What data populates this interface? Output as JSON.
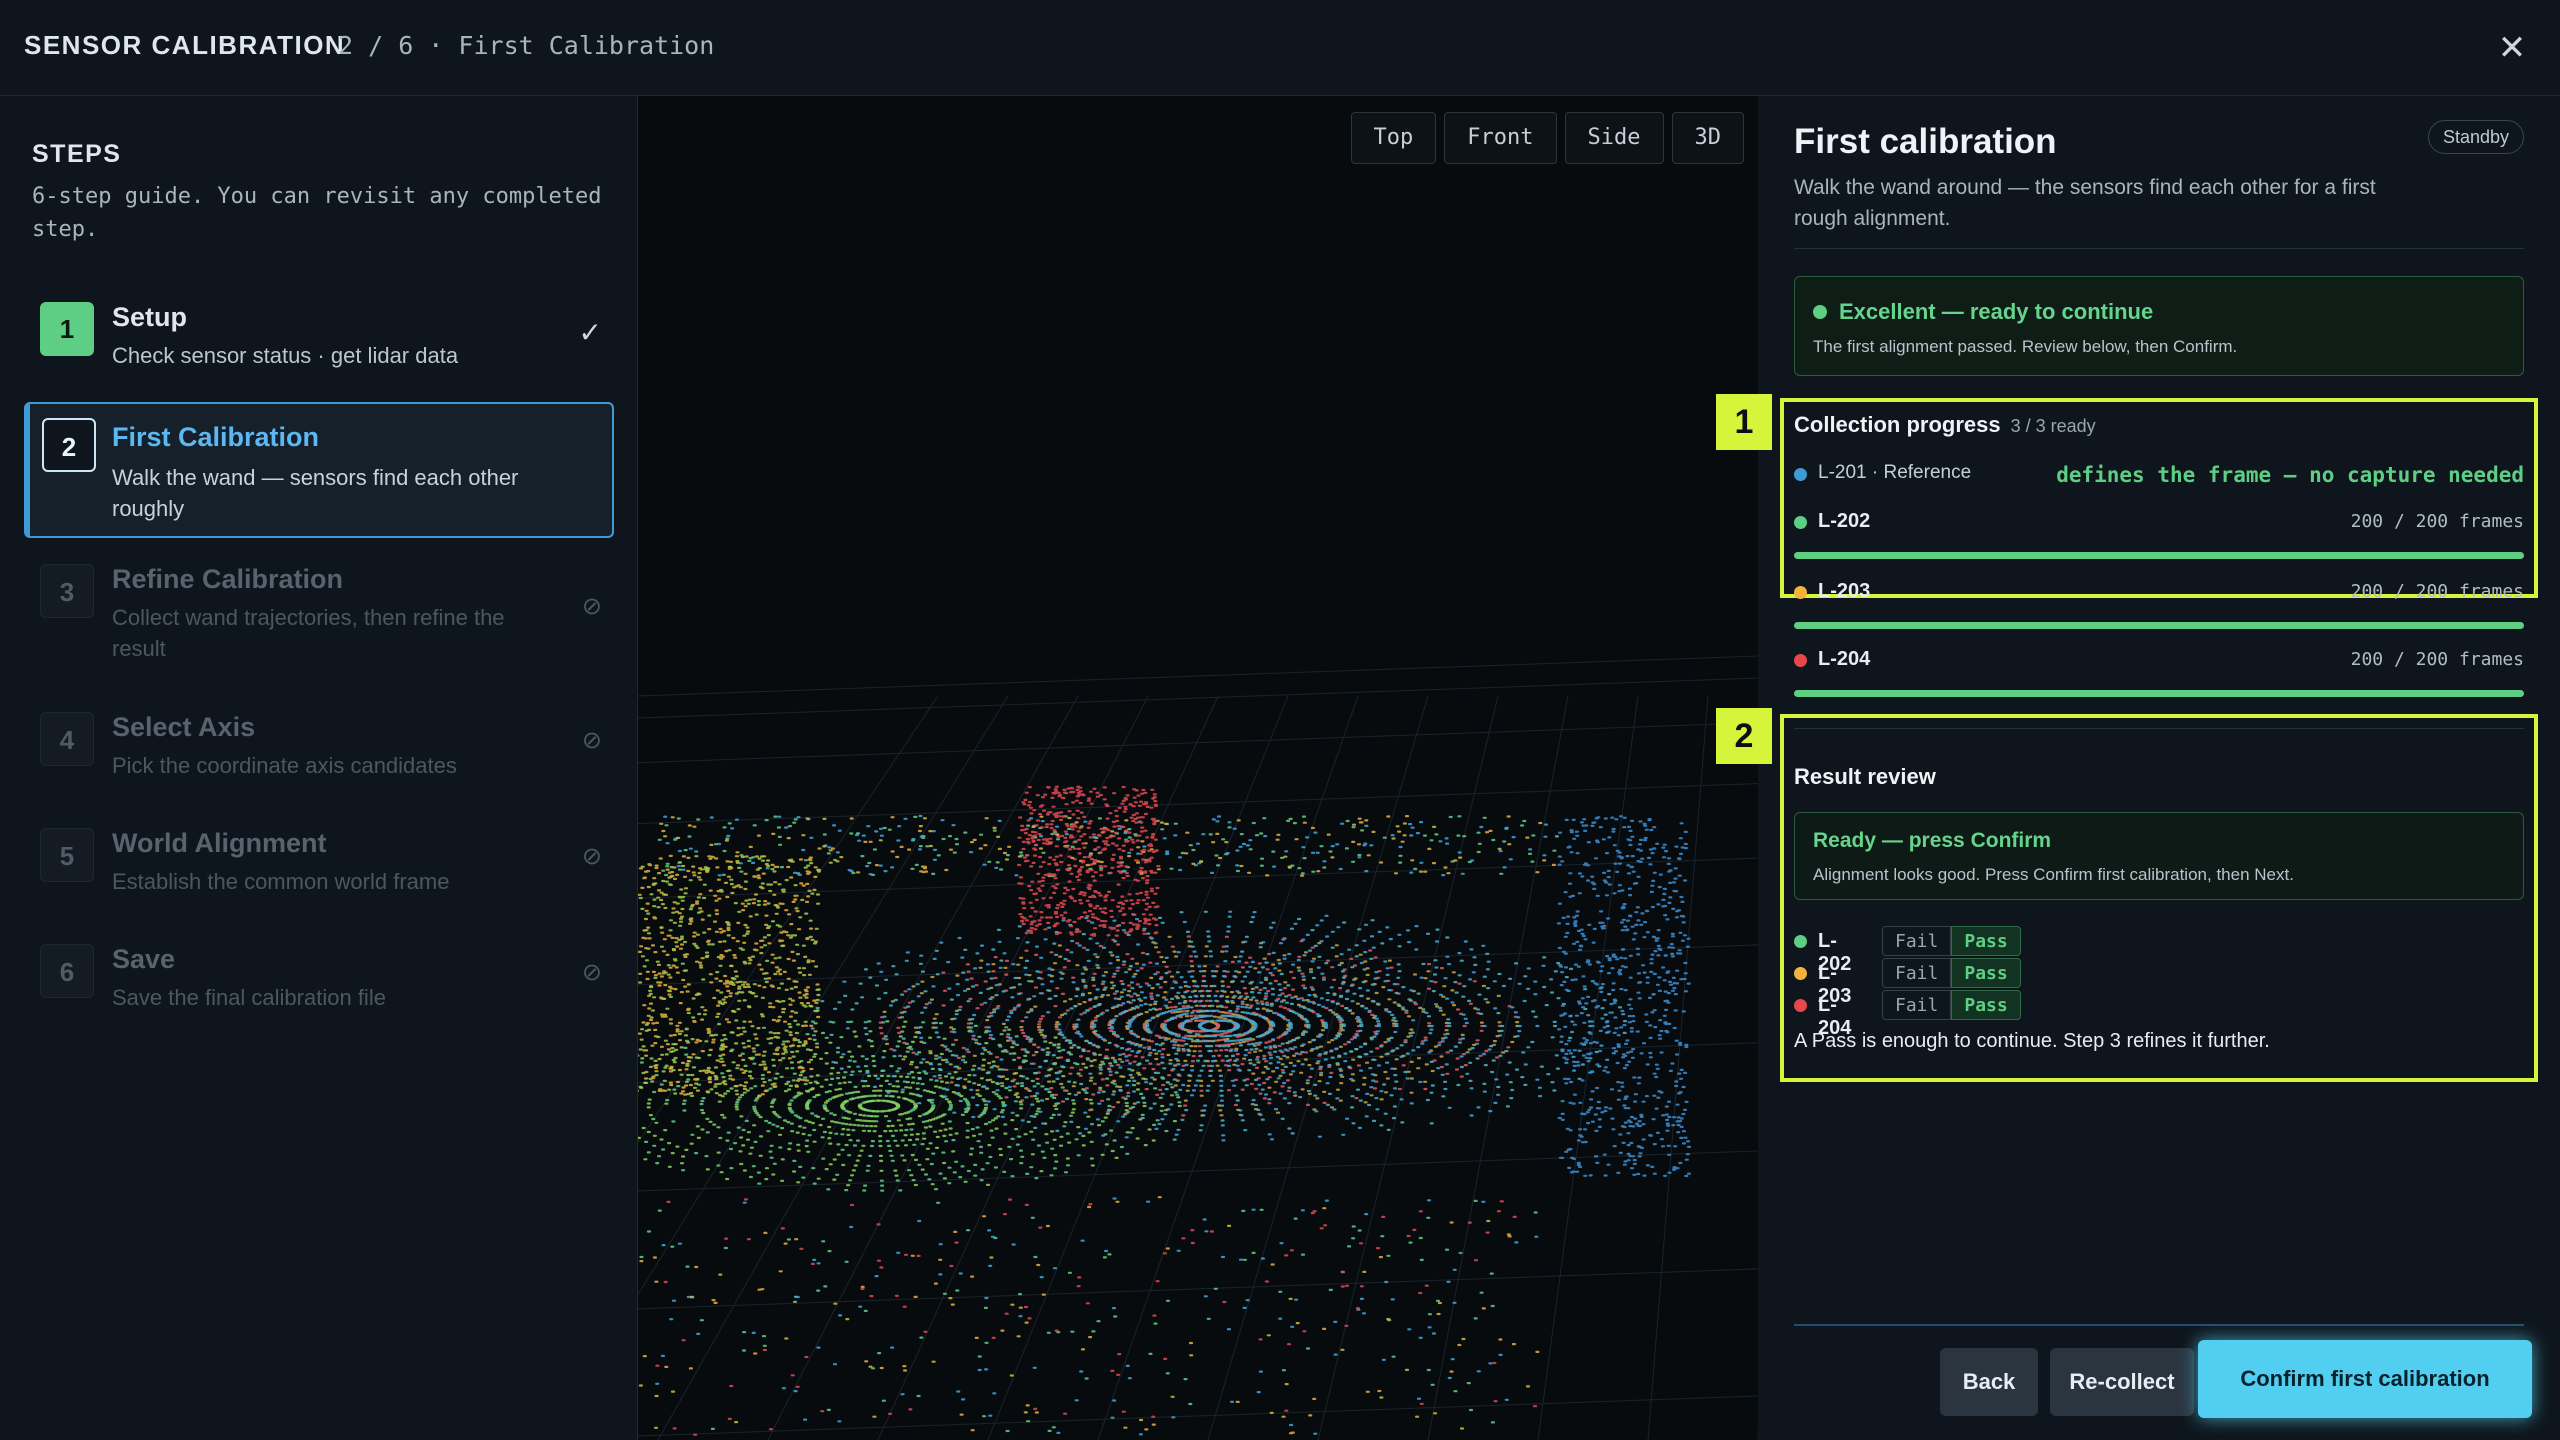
{
  "header": {
    "title": "SENSOR CALIBRATION",
    "breadcrumb": "2 / 6 · First Calibration",
    "close_glyph": "✕"
  },
  "sidebar": {
    "heading": "STEPS",
    "description": "6-step guide. You can revisit any completed step.",
    "steps": [
      {
        "number": "1",
        "title": "Setup",
        "subtitle": "Check sensor status · get lidar data",
        "state": "done",
        "status_glyph": "✓"
      },
      {
        "number": "2",
        "title": "First Calibration",
        "subtitle": "Walk the wand — sensors find each other roughly",
        "state": "active"
      },
      {
        "number": "3",
        "title": "Refine Calibration",
        "subtitle": "Collect wand trajectories, then refine the result",
        "state": "locked",
        "status_glyph": "⊘"
      },
      {
        "number": "4",
        "title": "Select Axis",
        "subtitle": "Pick the coordinate axis candidates",
        "state": "locked",
        "status_glyph": "⊘"
      },
      {
        "number": "5",
        "title": "World Alignment",
        "subtitle": "Establish the common world frame",
        "state": "locked",
        "status_glyph": "⊘"
      },
      {
        "number": "6",
        "title": "Save",
        "subtitle": "Save the final calibration file",
        "state": "locked",
        "status_glyph": "⊘"
      }
    ]
  },
  "viewport": {
    "view_buttons": [
      "Top",
      "Front",
      "Side",
      "3D"
    ]
  },
  "panel": {
    "title": "First calibration",
    "status_badge": "Standby",
    "description": "Walk the wand around — the sensors find each other for a first rough alignment.",
    "success": {
      "heading": "Excellent — ready to continue",
      "detail": "The first alignment passed. Review below, then Confirm."
    },
    "callouts": [
      "1",
      "2"
    ],
    "collection": {
      "heading": "Collection progress",
      "summary": "3 / 3 ready",
      "reference": {
        "name": "L-201 · Reference",
        "note": "defines the frame — no capture needed",
        "color": "#3f9bd6"
      },
      "sensors": [
        {
          "name": "L-202",
          "frames": "200 / 200 frames",
          "progress": 1.0,
          "color": "#5fce85"
        },
        {
          "name": "L-203",
          "frames": "200 / 200 frames",
          "progress": 1.0,
          "color": "#f2b33d"
        },
        {
          "name": "L-204",
          "frames": "200 / 200 frames",
          "progress": 1.0,
          "color": "#e8484b"
        }
      ]
    },
    "review": {
      "heading": "Result review",
      "ready_heading": "Ready — press Confirm",
      "ready_detail": "Alignment looks good. Press Confirm first calibration, then Next.",
      "fail_label": "Fail",
      "pass_label": "Pass",
      "results": [
        {
          "name": "L-202",
          "result": "Pass",
          "color": "#5fce85"
        },
        {
          "name": "L-203",
          "result": "Pass",
          "color": "#f2b33d"
        },
        {
          "name": "L-204",
          "result": "Pass",
          "color": "#e8484b"
        }
      ],
      "note": "A Pass is enough to continue. Step 3 refines it further."
    },
    "buttons": {
      "back": "Back",
      "recollect": "Re-collect",
      "confirm": "Confirm first calibration"
    }
  },
  "colors": {
    "accent": "#52cff0",
    "success": "#5fce85",
    "callout": "#d6f53a",
    "active_step": "#3f9bd6"
  }
}
